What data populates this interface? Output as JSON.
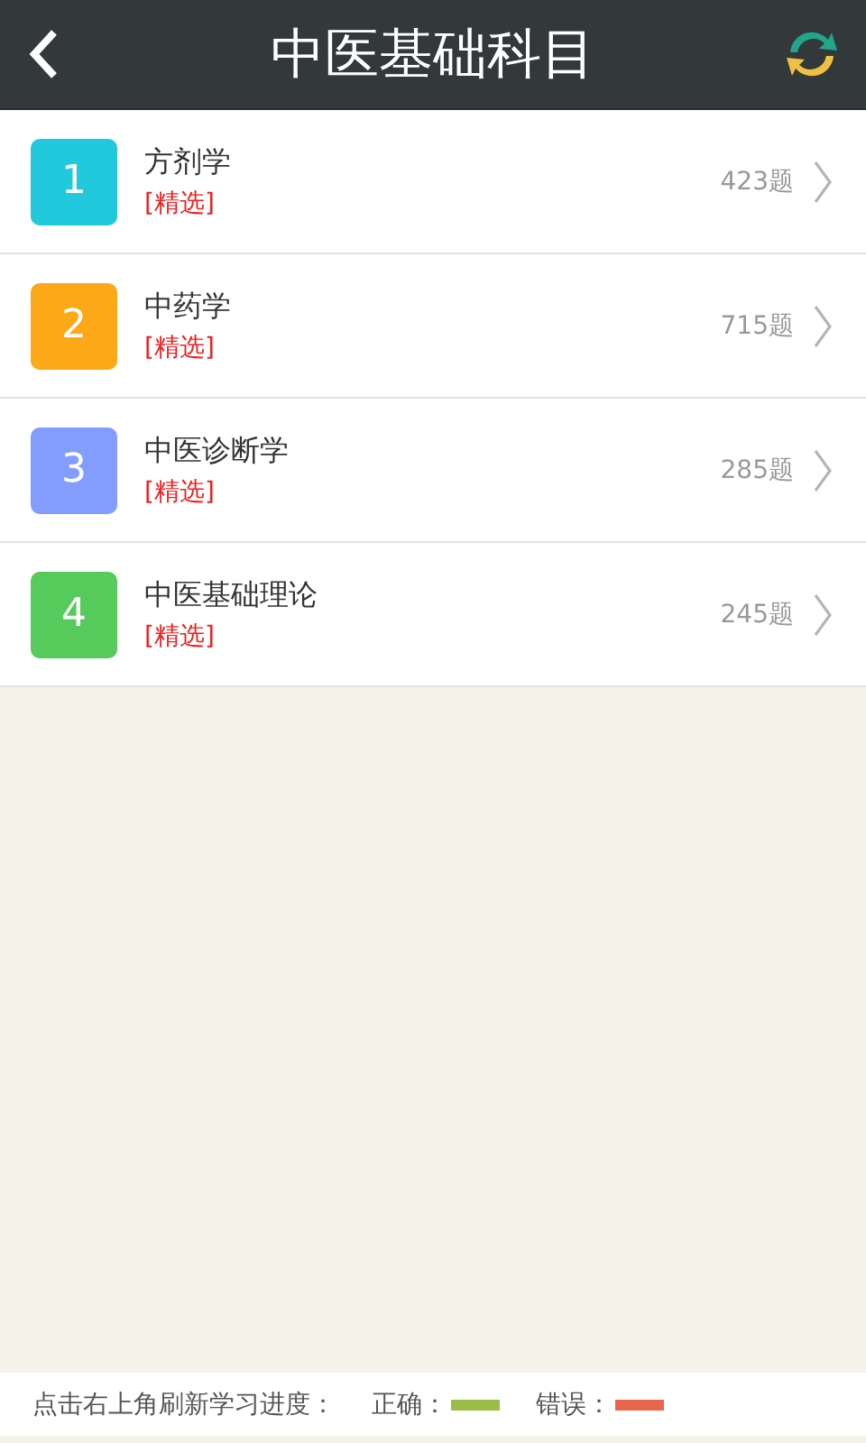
{
  "header": {
    "title": "中医基础科目"
  },
  "subjects": [
    {
      "number": "1",
      "name": "方剂学",
      "tag": "[精选]",
      "count": "423题",
      "color": "#22c8dc"
    },
    {
      "number": "2",
      "name": "中药学",
      "tag": "[精选]",
      "count": "715题",
      "color": "#fda816"
    },
    {
      "number": "3",
      "name": "中医诊断学",
      "tag": "[精选]",
      "count": "285题",
      "color": "#829dfe"
    },
    {
      "number": "4",
      "name": "中医基础理论",
      "tag": "[精选]",
      "count": "245题",
      "color": "#56ca5a"
    }
  ],
  "footer": {
    "hint": "点击右上角刷新学习进度：",
    "legend": [
      {
        "label": "正确：",
        "color": "#9bbd45"
      },
      {
        "label": "错误：",
        "color": "#e8664c"
      }
    ]
  }
}
